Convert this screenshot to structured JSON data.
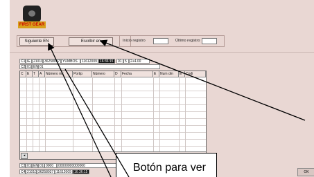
{
  "app": {
    "logo_text": "FIRST GEAR"
  },
  "toolbar": {
    "next_label": "Siguiente EN",
    "write_label": "Escribir en"
  },
  "registry": {
    "start_label": "Inicio registro",
    "end_label": "Último registro"
  },
  "records": {
    "row1": [
      "C1",
      "IE",
      "21010",
      "36258037",
      "YUMBOS",
      "11612009",
      "16:36:15",
      "01",
      "5",
      "2+4.00"
    ],
    "row2": [
      "C2",
      "01",
      "EN",
      "01"
    ],
    "bottom1": [
      "C3",
      "01",
      "EN",
      "01",
      "0000",
      "00000000000000"
    ],
    "bottom2": [
      "C4",
      "21010",
      "36258037",
      "11612009",
      "16:36:15"
    ]
  },
  "grid": {
    "headers": [
      "C",
      "E",
      "T",
      "A",
      "Número mx",
      "Portip",
      "Número",
      "D",
      "Fecha",
      "E",
      "Num dm",
      "E",
      "Codi"
    ]
  },
  "ok_label": "OK",
  "callout": {
    "text": "Botón para ver"
  }
}
